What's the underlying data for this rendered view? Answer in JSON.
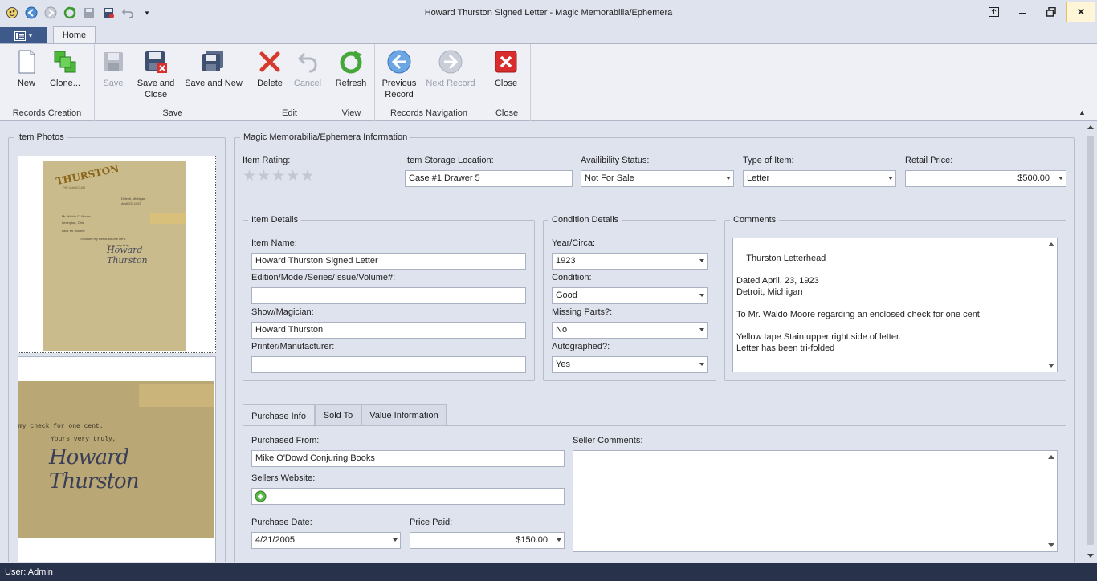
{
  "window": {
    "title": "Howard Thurston Signed Letter - Magic Memorabilia/Ephemera"
  },
  "ribbon": {
    "tab_home": "Home",
    "groups": {
      "records_creation": "Records Creation",
      "save": "Save",
      "edit": "Edit",
      "view": "View",
      "records_navigation": "Records Navigation",
      "close": "Close"
    },
    "buttons": {
      "new": "New",
      "clone": "Clone...",
      "save": "Save",
      "save_and_close": "Save and Close",
      "save_and_new": "Save and New",
      "delete": "Delete",
      "cancel": "Cancel",
      "refresh": "Refresh",
      "previous_record": "Previous Record",
      "next_record": "Next Record",
      "close": "Close"
    }
  },
  "photos": {
    "header": "Item Photos",
    "letterhead": "THURSTON",
    "letterhead_sub": "THE MAGICIAN",
    "place": "Detroit, Michigan",
    "date": "April 23, 1923",
    "to": "Mr. Waldo C. Moore",
    "town": "Lexington, Ohio",
    "salutation": "Dear Mr. Moore:",
    "body": "Enclosed my check for one cent.",
    "closing": "Yours very truly,",
    "close_body": "my check for one cent.",
    "signature": "Howard Thurston"
  },
  "info": {
    "header": "Magic Memorabilia/Ephemera Information",
    "item_rating_label": "Item Rating:",
    "rating": 0,
    "rating_max": 5,
    "storage_label": "Item Storage Location:",
    "storage_value": "Case #1 Drawer 5",
    "availability_label": "Availibility Status:",
    "availability_value": "Not For Sale",
    "type_label": "Type of Item:",
    "type_value": "Letter",
    "retail_label": "Retail Price:",
    "retail_value": "$500.00"
  },
  "item_details": {
    "header": "Item Details",
    "name_label": "Item Name:",
    "name_value": "Howard Thurston Signed Letter",
    "edition_label": "Edition/Model/Series/Issue/Volume#:",
    "edition_value": "",
    "show_label": "Show/Magician:",
    "show_value": "Howard Thurston",
    "printer_label": "Printer/Manufacturer:",
    "printer_value": ""
  },
  "condition": {
    "header": "Condition Details",
    "year_label": "Year/Circa:",
    "year_value": "1923",
    "condition_label": "Condition:",
    "condition_value": "Good",
    "missing_label": "Missing Parts?:",
    "missing_value": "No",
    "autographed_label": "Autographed?:",
    "autographed_value": "Yes"
  },
  "comments": {
    "header": "Comments",
    "text": "Thurston Letterhead\n\nDated April, 23, 1923\nDetroit, Michigan\n\nTo Mr. Waldo Moore regarding an enclosed check for one cent\n\nYellow tape Stain upper right side of letter.\nLetter has been tri-folded"
  },
  "tabs": [
    "Purchase Info",
    "Sold To",
    "Value Information"
  ],
  "purchase": {
    "from_label": "Purchased From:",
    "from_value": "Mike O'Dowd Conjuring Books",
    "website_label": "Sellers Website:",
    "website_value": "",
    "date_label": "Purchase Date:",
    "date_value": "4/21/2005",
    "price_label": "Price Paid:",
    "price_value": "$150.00",
    "seller_comments_label": "Seller Comments:",
    "seller_comments_value": ""
  },
  "status": {
    "user": "User: Admin"
  },
  "colors": {
    "accent": "#3d5a8a",
    "status_bar": "#28324a",
    "background": "#dfe3ee"
  }
}
